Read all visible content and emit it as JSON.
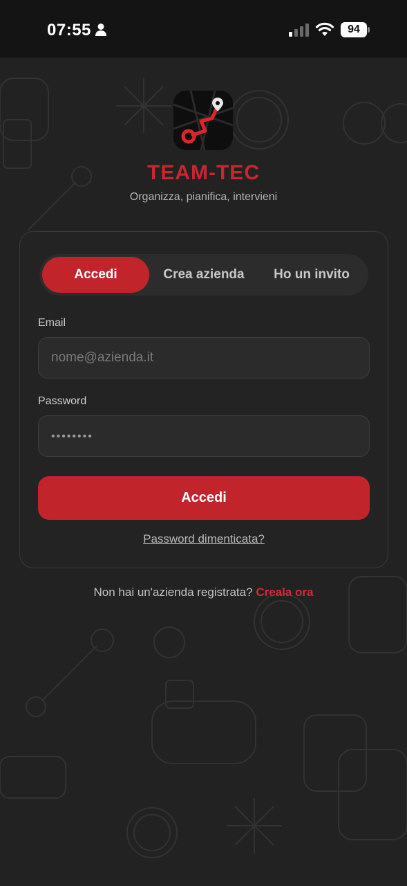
{
  "status_bar": {
    "time": "07:55",
    "battery": "94",
    "icons": [
      "person-icon",
      "cellular-signal-icon",
      "wifi-icon",
      "battery-icon"
    ]
  },
  "app": {
    "logo_icon": "route-wrench-logo-icon",
    "name": "TEAM-TEC",
    "tagline": "Organizza, pianifica, intervieni"
  },
  "tabs": [
    {
      "label": "Accedi",
      "active": true
    },
    {
      "label": "Crea azienda",
      "active": false
    },
    {
      "label": "Ho un invito",
      "active": false
    }
  ],
  "form": {
    "email_label": "Email",
    "email_placeholder": "nome@azienda.it",
    "password_label": "Password",
    "password_value": "••••••••",
    "submit_label": "Accedi",
    "forgot_link": "Password dimenticata?"
  },
  "footer": {
    "prompt": "Non hai un'azienda registrata?",
    "link": "Creala ora"
  },
  "colors": {
    "accent": "#c2242c",
    "background": "#222222",
    "card": "#242424"
  }
}
